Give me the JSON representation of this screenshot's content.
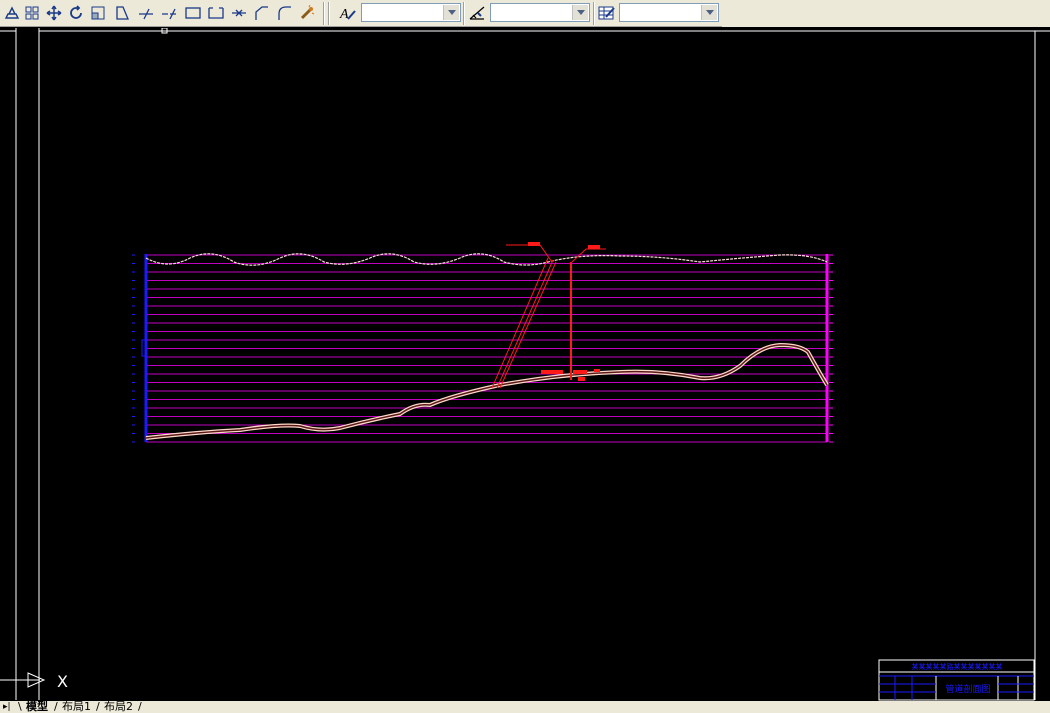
{
  "toolbar": {
    "icons": [
      "plot-icon",
      "array-icon",
      "move-icon",
      "rotate-icon",
      "scale-icon",
      "stretch-icon",
      "trim-icon",
      "extend-icon",
      "break-icon",
      "break-at-point-icon",
      "join-icon",
      "chamfer-icon",
      "fillet-icon",
      "explode-icon"
    ],
    "text_style_value": "",
    "dim_style_value": "",
    "table_style_value": ""
  },
  "ucs": {
    "x_label": "X"
  },
  "title_block": {
    "title": "某某某某某路某某某某某某某",
    "drawing_name": "管道剖面图"
  },
  "tabs": {
    "model": "模型",
    "layout1": "布局1",
    "layout2": "布局2"
  },
  "colors": {
    "magenta": "#ff00ff",
    "red": "#ff1a1a",
    "blue": "#1a1aff",
    "white": "#ffffff"
  }
}
